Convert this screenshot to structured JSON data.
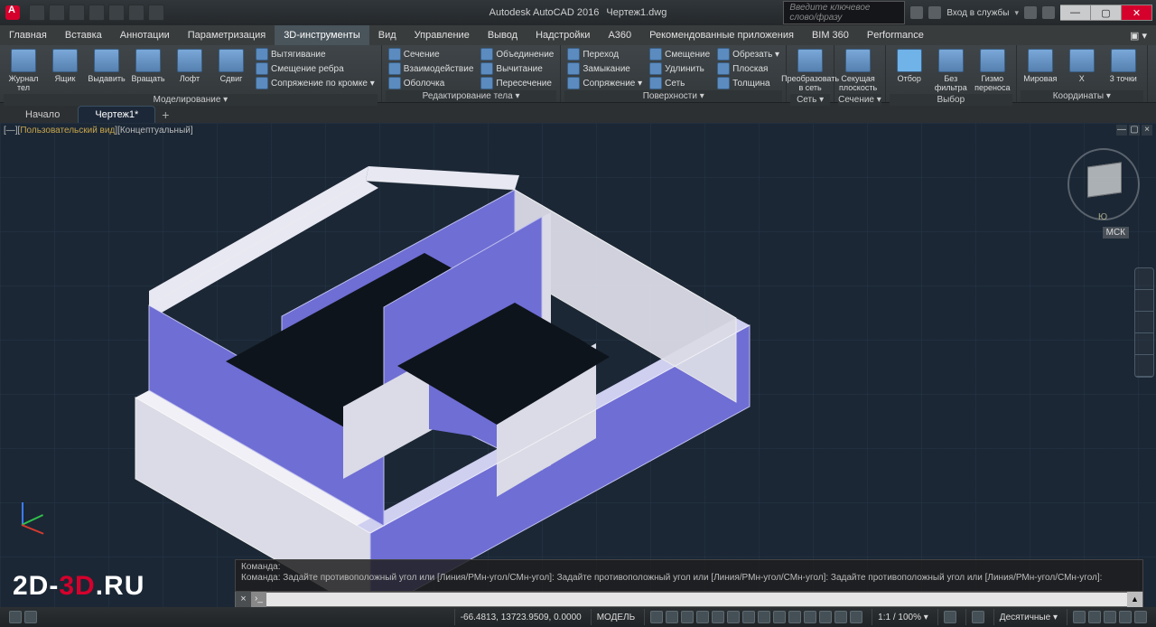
{
  "title": {
    "app": "Autodesk AutoCAD 2016",
    "file": "Чертеж1.dwg"
  },
  "search": {
    "placeholder": "Введите ключевое слово/фразу"
  },
  "login": {
    "label": "Вход в службы"
  },
  "menu": {
    "items": [
      "Главная",
      "Вставка",
      "Аннотации",
      "Параметризация",
      "3D-инструменты",
      "Вид",
      "Управление",
      "Вывод",
      "Надстройки",
      "A360",
      "Рекомендованные приложения",
      "BIM 360",
      "Performance"
    ],
    "active_index": 4
  },
  "ribbon": {
    "g0": {
      "caption": "Моделирование ▾",
      "big": [
        {
          "label": "Журнал\nтел"
        },
        {
          "label": "Ящик"
        },
        {
          "label": "Выдавить"
        },
        {
          "label": "Вращать"
        },
        {
          "label": "Лофт"
        },
        {
          "label": "Сдвиг"
        }
      ],
      "col": [
        "Вытягивание",
        "Смещение ребра",
        "Сопряжение по кромке ▾"
      ]
    },
    "g1": {
      "caption": "Редактирование тела ▾",
      "colA": [
        "Сечение",
        "Взаимодействие",
        "Оболочка"
      ],
      "colB": [
        "Объединение",
        "Вычитание",
        "Пересечение"
      ]
    },
    "g2": {
      "caption": "Поверхности ▾",
      "colA": [
        "Переход",
        "Замыкание",
        "Сопряжение ▾"
      ],
      "colB": [
        "Смещение",
        "Удлинить",
        "Сеть"
      ],
      "colC": [
        "Обрезать ▾",
        "Плоская",
        "Толщина"
      ]
    },
    "g3": {
      "caption": "Сеть ▾",
      "big": [
        {
          "label": "Преобразовать\nв сеть"
        }
      ]
    },
    "g4": {
      "caption": "Сечение ▾",
      "big": [
        {
          "label": "Секущая\nплоскость"
        }
      ]
    },
    "g5": {
      "caption": "Выбор",
      "big": [
        {
          "label": "Отбор",
          "sel": true
        },
        {
          "label": "Без фильтра"
        },
        {
          "label": "Гизмо\nпереноса"
        }
      ]
    },
    "g6": {
      "caption": "Координаты ▾",
      "big": [
        {
          "label": "Мировая"
        },
        {
          "label": "X"
        },
        {
          "label": "3 точки"
        }
      ]
    }
  },
  "doctabs": {
    "start": "Начало",
    "active": "Чертеж1*"
  },
  "viewport": {
    "hint_left": "Пользовательский вид",
    "hint_right": "Концептуальный",
    "south": "Ю",
    "wcs": "МСК"
  },
  "cmd": {
    "title": "Команда:",
    "hist": "Команда: Задайте противоположный угол или [Линия/РМн-угол/СМн-угол]:  Задайте противоположный угол или [Линия/РМн-угол/СМн-угол]:  Задайте противоположный угол или [Линия/РМн-угол/СМн-угол]:",
    "placeholder": ""
  },
  "status": {
    "coords": "-66.4813, 13723.9509, 0.0000",
    "space": "МОДЕЛЬ",
    "scale": "1:1 / 100% ▾",
    "units": "Десятичные ▾"
  },
  "watermark": {
    "a": "2D-",
    "b": "3D",
    "c": ".RU"
  }
}
